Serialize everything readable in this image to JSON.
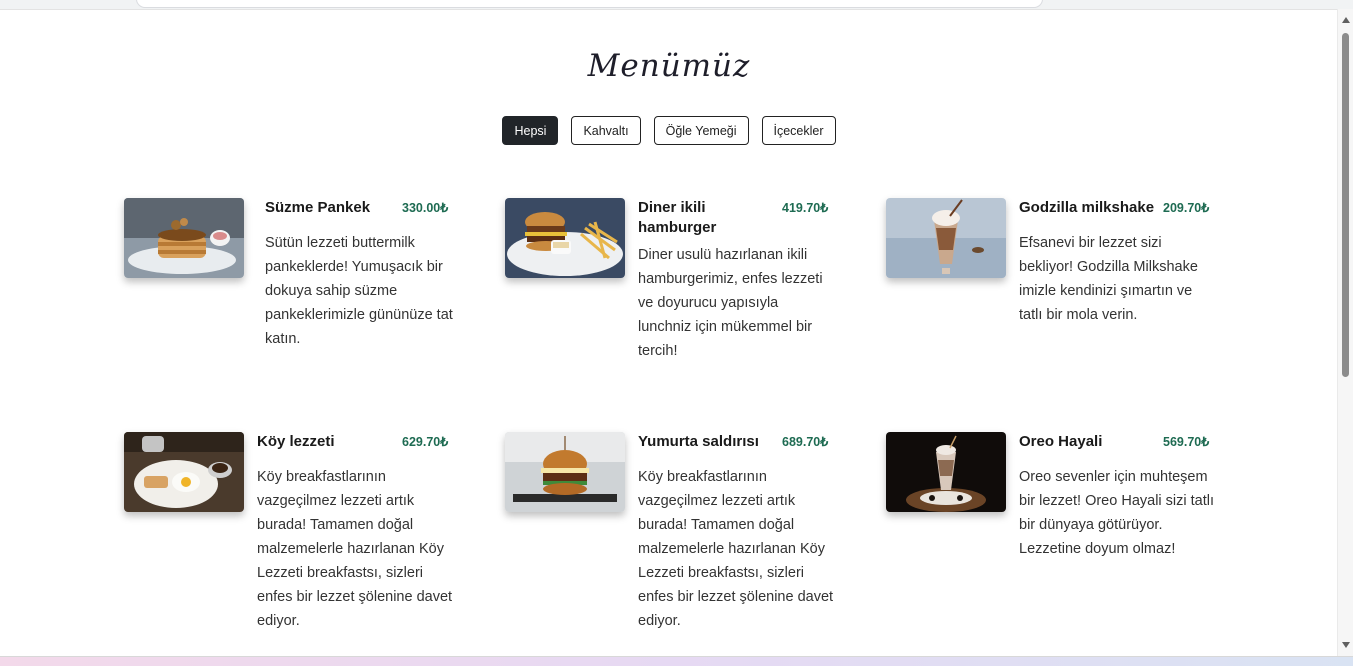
{
  "page": {
    "title": "Menümüz"
  },
  "filters": [
    {
      "label": "Hepsi",
      "active": true
    },
    {
      "label": "Kahvaltı",
      "active": false
    },
    {
      "label": "Öğle Yemeği",
      "active": false
    },
    {
      "label": "İçecekler",
      "active": false
    }
  ],
  "items": [
    {
      "name": "Süzme Pankek",
      "price": "330.00₺",
      "description": "Sütün lezzeti buttermilk pankeklerde! Yumuşacık bir dokuya sahip süzme pankeklerimizle gününüze tat katın.",
      "image": "pancake-stack-photo"
    },
    {
      "name": "Diner ikili hamburger",
      "price": "419.70₺",
      "description": "Diner usulü hazırlanan ikili hamburgerimiz, enfes lezzeti ve doyurucu yapısıyla lunchniz için mükemmel bir tercih!",
      "image": "burger-fries-photo"
    },
    {
      "name": "Godzilla milkshake",
      "price": "209.70₺",
      "description": "Efsanevi bir lezzet sizi bekliyor! Godzilla Milkshake imizle kendinizi şımartın ve tatlı bir mola verin.",
      "image": "milkshake-photo"
    },
    {
      "name": "Köy lezzeti",
      "price": "629.70₺",
      "description": "Köy breakfastlarının vazgeçilmez lezzeti artık burada! Tamamen doğal malzemelerle hazırlanan Köy Lezzeti breakfastsı, sizleri enfes bir lezzet şölenine davet ediyor.",
      "image": "breakfast-plate-photo"
    },
    {
      "name": "Yumurta saldırısı",
      "price": "689.70₺",
      "description": "Köy breakfastlarının vazgeçilmez lezzeti artık burada! Tamamen doğal malzemelerle hazırlanan Köy Lezzeti breakfastsı, sizleri enfes bir lezzet şölenine davet ediyor.",
      "image": "egg-burger-photo"
    },
    {
      "name": "Oreo Hayali",
      "price": "569.70₺",
      "description": "Oreo sevenler için muhteşem bir lezzet! Oreo Hayali sizi tatlı bir dünyaya götürüyor. Lezzetine doyum olmaz!",
      "image": "oreo-shake-photo"
    }
  ],
  "colors": {
    "price": "#1e6b52",
    "active_filter": "#212529"
  }
}
